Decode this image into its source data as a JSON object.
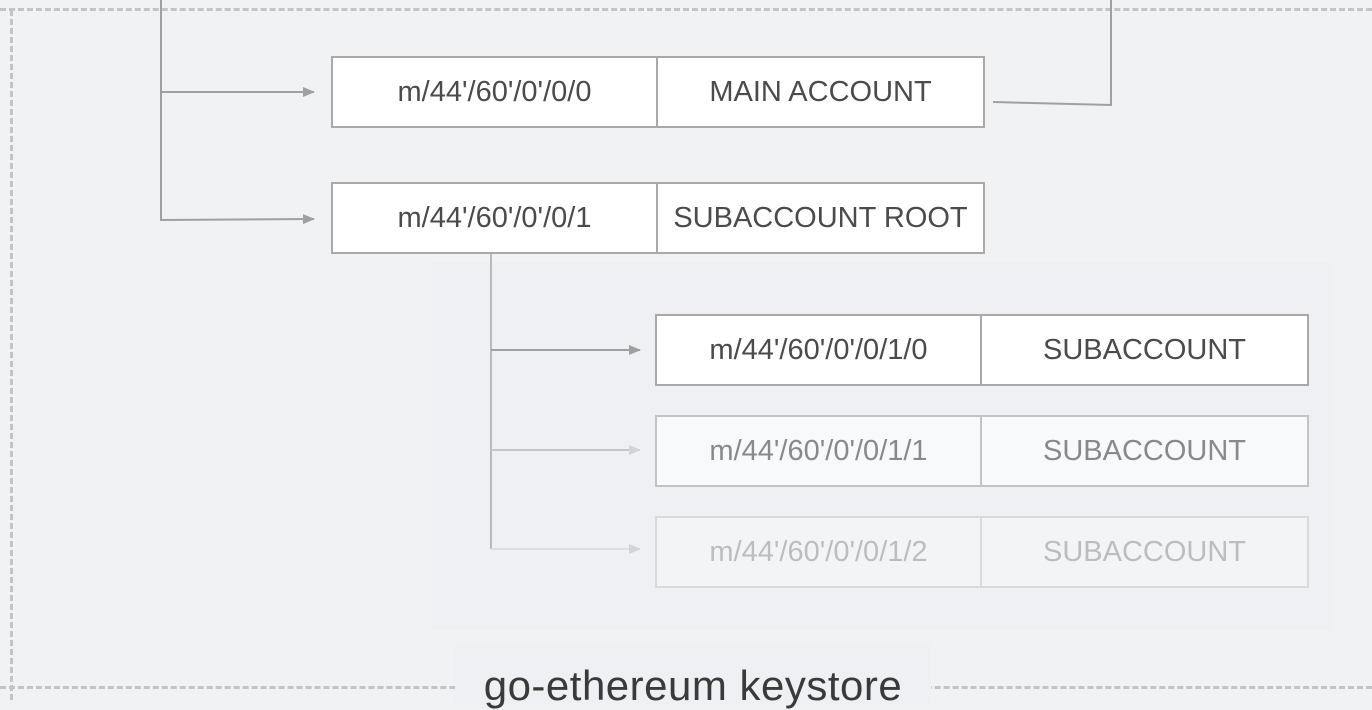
{
  "nodes": {
    "main_account": {
      "path": "m/44'/60'/0'/0/0",
      "label": "MAIN ACCOUNT"
    },
    "subaccount_root": {
      "path": "m/44'/60'/0'/0/1",
      "label": "SUBACCOUNT ROOT"
    },
    "subaccounts": [
      {
        "path": "m/44'/60'/0'/0/1/0",
        "label": "SUBACCOUNT"
      },
      {
        "path": "m/44'/60'/0'/0/1/1",
        "label": "SUBACCOUNT"
      },
      {
        "path": "m/44'/60'/0'/0/1/2",
        "label": "SUBACCOUNT"
      }
    ]
  },
  "container": {
    "caption": "go-ethereum keystore"
  },
  "colors": {
    "background": "#f1f2f4",
    "node_border": "#a9a9a9",
    "text": "#4b4b4b",
    "connector": "#a0a0a0",
    "frame_dash": "#c2c4c8"
  }
}
